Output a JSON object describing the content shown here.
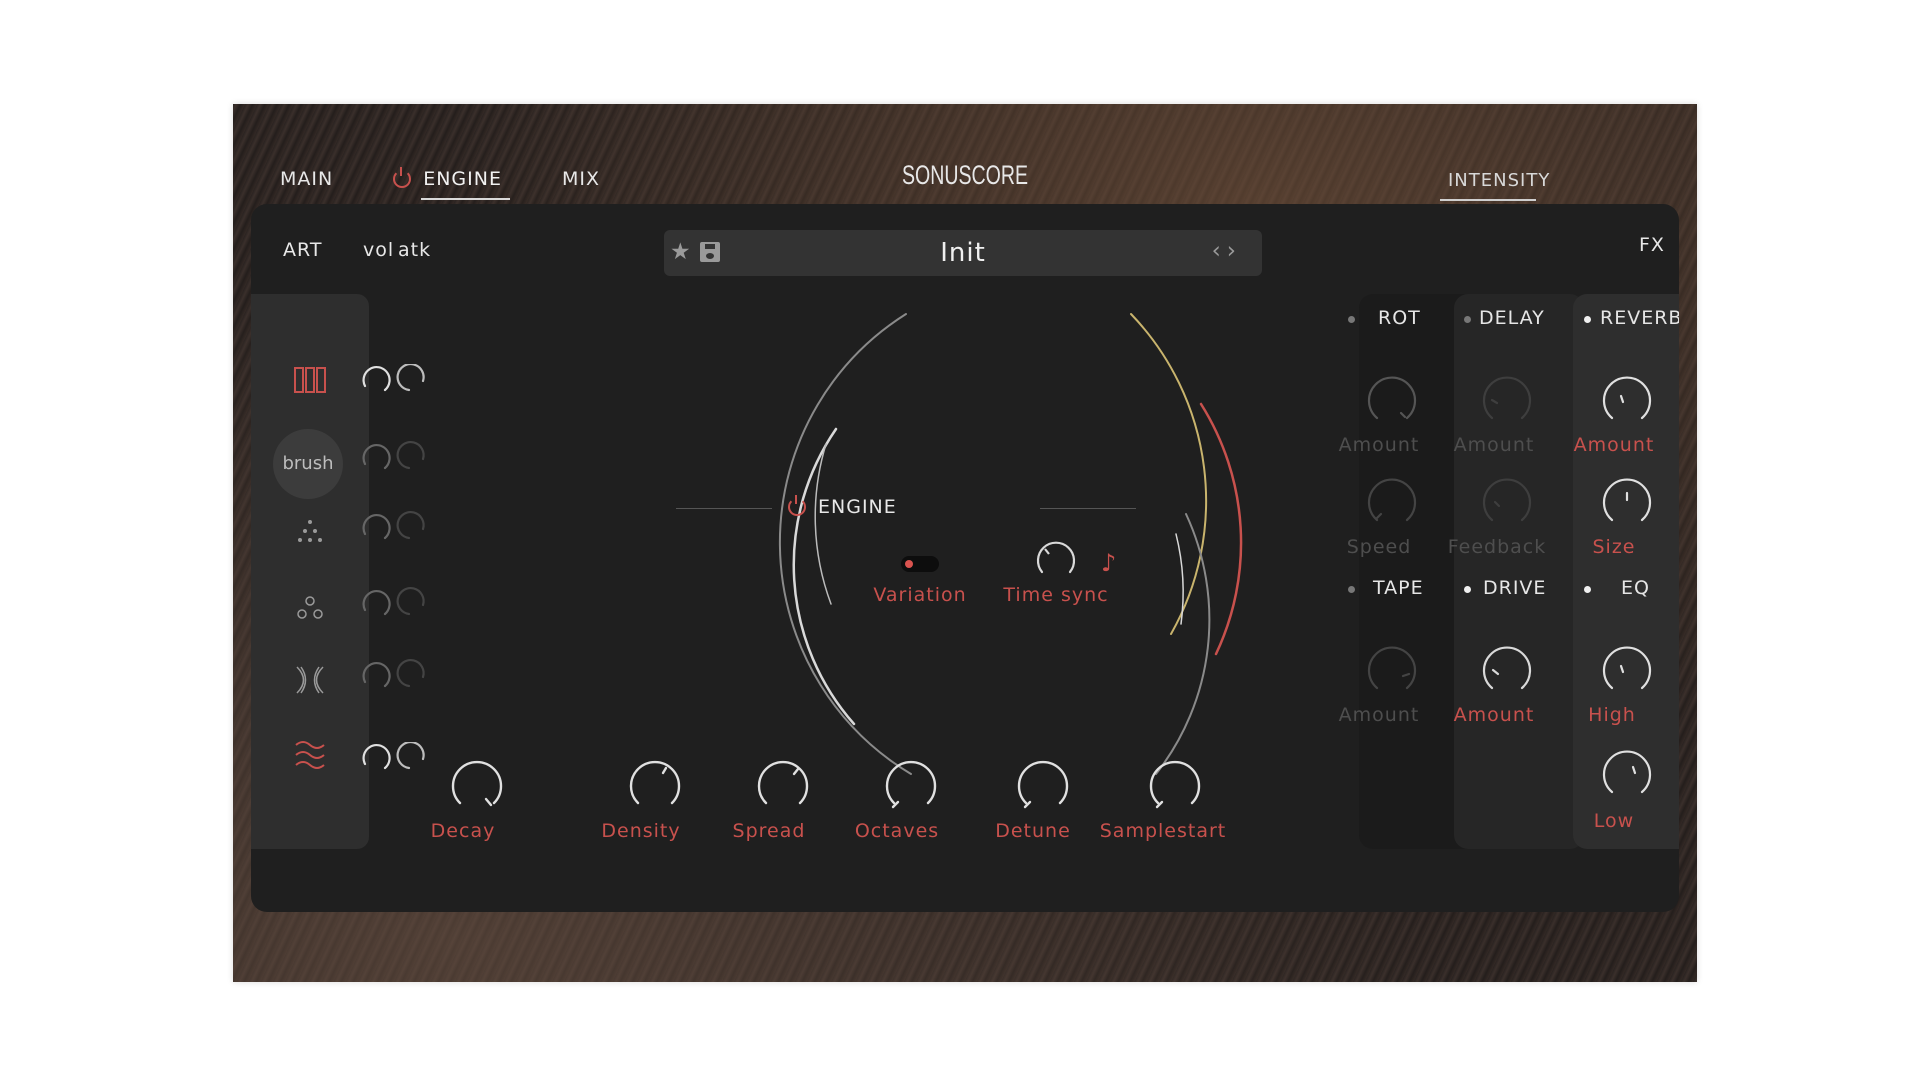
{
  "nav": {
    "tabs": [
      {
        "label": "MAIN"
      },
      {
        "label": "ENGINE"
      },
      {
        "label": "MIX"
      }
    ],
    "brand": "SONUSCORE",
    "intensity_label": "INTENSITY"
  },
  "panel": {
    "art_label": "ART",
    "vol_label": "vol",
    "atk_label": "atk",
    "fx_label": "FX",
    "preset_name": "Init",
    "brush_label": "brush",
    "sidebar_icons": [
      "keys-icon",
      "brush-button",
      "dots-triangle-icon",
      "circles-cluster-icon",
      "x-lines-icon",
      "waves-icon"
    ]
  },
  "engine": {
    "title": "ENGINE",
    "variation_label": "Variation",
    "timesync_label": "Time sync"
  },
  "bottom_knobs": {
    "decay": "Decay",
    "density": "Density",
    "spread": "Spread",
    "octaves": "Octaves",
    "detune": "Detune",
    "samplestart": "Samplestart"
  },
  "fx": {
    "rot": {
      "title": "ROT",
      "amount": "Amount",
      "speed": "Speed"
    },
    "tape": {
      "title": "TAPE",
      "amount": "Amount"
    },
    "delay": {
      "title": "DELAY",
      "amount": "Amount",
      "feedback": "Feedback"
    },
    "drive": {
      "title": "DRIVE",
      "amount": "Amount"
    },
    "reverb": {
      "title": "REVERB",
      "amount": "Amount",
      "size": "Size"
    },
    "eq": {
      "title": "EQ",
      "high": "High",
      "low": "Low"
    }
  },
  "colors": {
    "accent": "#c8514d",
    "panel": "#1f1f1f",
    "text": "#e8e8e8",
    "dim": "#4e4e4e"
  }
}
